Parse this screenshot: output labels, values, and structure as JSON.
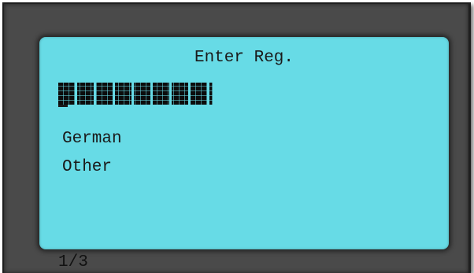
{
  "screen": {
    "title": "Enter Reg.",
    "options": [
      {
        "label": "German"
      },
      {
        "label": "Other"
      }
    ]
  },
  "footer": {
    "page_indicator": "1/3"
  },
  "colors": {
    "screen_background": "#67dbe6",
    "bezel": "#4a4a4a",
    "text": "#1a1a1a"
  }
}
